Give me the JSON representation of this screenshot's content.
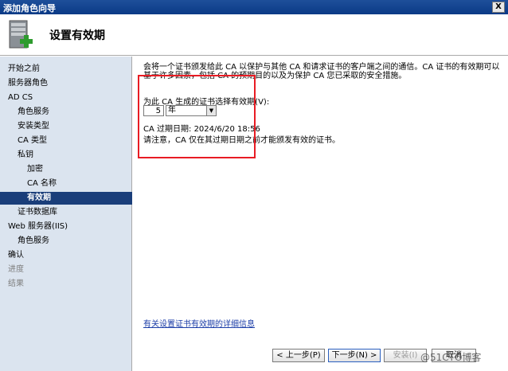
{
  "window": {
    "title": "添加角色向导",
    "close_glyph": "X"
  },
  "header": {
    "title": "设置有效期",
    "icon": "server-add-icon"
  },
  "sidebar": {
    "items": [
      {
        "label": "开始之前",
        "level": 0,
        "state": "normal"
      },
      {
        "label": "服务器角色",
        "level": 0,
        "state": "normal"
      },
      {
        "label": "AD CS",
        "level": 0,
        "state": "normal"
      },
      {
        "label": "角色服务",
        "level": 1,
        "state": "normal"
      },
      {
        "label": "安装类型",
        "level": 1,
        "state": "normal"
      },
      {
        "label": "CA 类型",
        "level": 1,
        "state": "normal"
      },
      {
        "label": "私钥",
        "level": 1,
        "state": "normal"
      },
      {
        "label": "加密",
        "level": 2,
        "state": "normal"
      },
      {
        "label": "CA 名称",
        "level": 2,
        "state": "normal"
      },
      {
        "label": "有效期",
        "level": 2,
        "state": "active"
      },
      {
        "label": "证书数据库",
        "level": 1,
        "state": "normal"
      },
      {
        "label": "Web 服务器(IIS)",
        "level": 0,
        "state": "normal"
      },
      {
        "label": "角色服务",
        "level": 1,
        "state": "normal"
      },
      {
        "label": "确认",
        "level": 0,
        "state": "normal"
      },
      {
        "label": "进度",
        "level": 0,
        "state": "disabled"
      },
      {
        "label": "结果",
        "level": 0,
        "state": "disabled"
      }
    ]
  },
  "main": {
    "intro_line1": "会将一个证书颁发给此 CA 以保护与其他 CA 和请求证书的客户端之间的通信。CA 证书的有效期可以",
    "intro_line2": "基于许多因素，包括 CA 的预期目的以及为保护 CA 您已采取的安全措施。",
    "prompt": "为此 CA 生成的证书选择有效期(V):",
    "period_value": "5",
    "period_unit": "年",
    "expiry_label": "CA 过期日期:",
    "expiry_date": "2024/6/20 18:56",
    "note": "请注意，CA 仅在其过期日期之前才能颁发有效的证书。",
    "help_link": "有关设置证书有效期的详细信息"
  },
  "buttons": {
    "prev": "< 上一步(P)",
    "next": "下一步(N) >",
    "install": "安装(I)",
    "cancel": "取消"
  },
  "watermark": "@51CTO博客",
  "colors": {
    "annotation_box": "#e81c24",
    "active_nav": "#1a3e7a",
    "sidebar_bg": "#dbe4ef"
  }
}
